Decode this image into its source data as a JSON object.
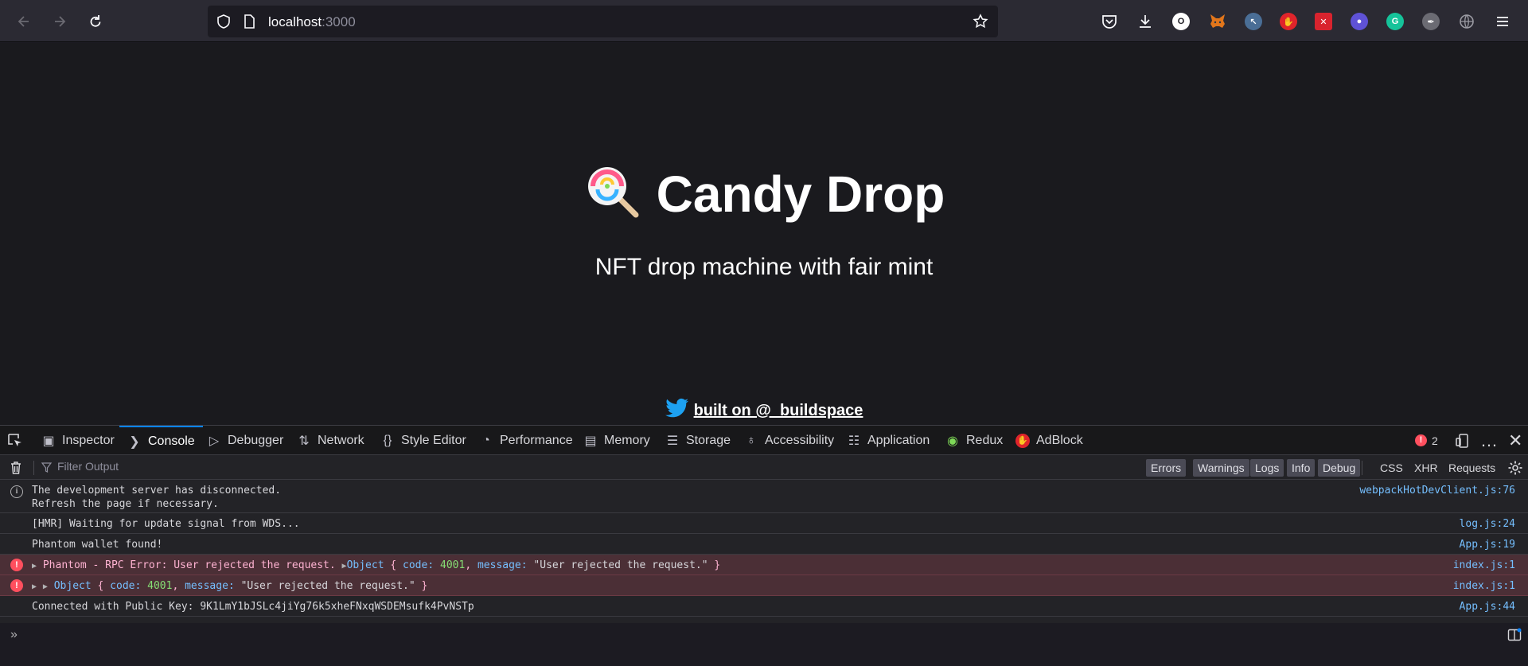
{
  "browser": {
    "url_host": "localhost",
    "url_port": ":3000",
    "extensions": [
      {
        "name": "pocket-icon"
      },
      {
        "name": "download-icon"
      },
      {
        "name": "opera-icon",
        "glyph": "O",
        "color": "#ffffff"
      },
      {
        "name": "metamask-icon",
        "color": "#e2761b"
      },
      {
        "name": "cursor-ext-icon",
        "color": "#4a6e96"
      },
      {
        "name": "stop-hand-icon",
        "color": "#e0242b"
      },
      {
        "name": "color-picker-icon",
        "color": "#d9232e"
      },
      {
        "name": "ghost-ext-icon",
        "color": "#5f52d6"
      },
      {
        "name": "grammarly-icon",
        "glyph": "G",
        "color": "#15c39a"
      },
      {
        "name": "feather-icon",
        "color": "#6b6b73"
      },
      {
        "name": "globe-icon",
        "color": "#9b9ba3"
      }
    ]
  },
  "page": {
    "title": "Candy Drop",
    "subtitle": "NFT drop machine with fair mint",
    "footer_link": "built on @_buildspace"
  },
  "devtools": {
    "tabs": [
      {
        "label": "Inspector"
      },
      {
        "label": "Console"
      },
      {
        "label": "Debugger"
      },
      {
        "label": "Network"
      },
      {
        "label": "Style Editor"
      },
      {
        "label": "Performance"
      },
      {
        "label": "Memory"
      },
      {
        "label": "Storage"
      },
      {
        "label": "Accessibility"
      },
      {
        "label": "Application"
      },
      {
        "label": "Redux"
      },
      {
        "label": "AdBlock"
      }
    ],
    "error_count": "2",
    "filter_placeholder": "Filter Output",
    "filter_buttons": [
      "Errors",
      "Warnings",
      "Logs",
      "Info",
      "Debug"
    ],
    "filter_links": [
      "CSS",
      "XHR",
      "Requests"
    ],
    "logs": [
      {
        "type": "info",
        "lines": [
          "The development server has disconnected.",
          "Refresh the page if necessary."
        ],
        "source": "webpackHotDevClient.js:76"
      },
      {
        "type": "log",
        "text": "[HMR] Waiting for update signal from WDS...",
        "source": "log.js:24"
      },
      {
        "type": "log",
        "text": "Phantom wallet found!",
        "source": "App.js:19"
      },
      {
        "type": "error",
        "prefix": "Phantom - RPC Error: User rejected the request.",
        "obj_label": "Object",
        "code_key": "code:",
        "code_val": "4001",
        "msg_key": "message:",
        "msg_val": "\"User rejected the request.\"",
        "source": "index.js:1"
      },
      {
        "type": "error",
        "obj_label": "Object",
        "code_key": "code:",
        "code_val": "4001",
        "msg_key": "message:",
        "msg_val": "\"User rejected the request.\"",
        "source": "index.js:1"
      },
      {
        "type": "log",
        "text": "Connected with Public Key: 9K1LmY1bJSLc4jiYg76k5xheFNxqWSDEMsufk4PvNSTp",
        "source": "App.js:44"
      }
    ]
  }
}
